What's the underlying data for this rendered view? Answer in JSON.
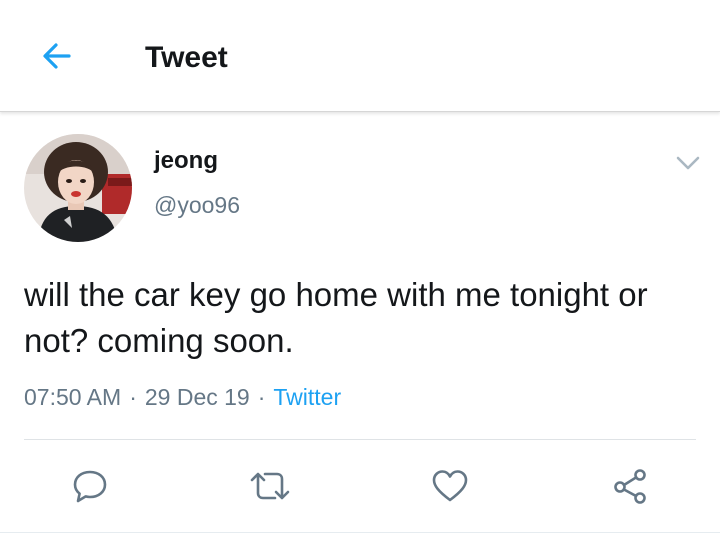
{
  "colors": {
    "accent": "#1da1f2",
    "secondary_text": "#657786",
    "primary_text": "#14171a",
    "icon_gray": "#657786"
  },
  "header": {
    "back_icon": "arrow-left-icon",
    "title": "Tweet"
  },
  "tweet": {
    "author": {
      "avatar_icon": "profile-photo",
      "display_name": "jeong",
      "handle": "@yoo96"
    },
    "menu_icon": "chevron-down-icon",
    "text": "will the car key go home with me tonight or not? coming soon.",
    "time": "07:50 AM",
    "date": "29 Dec 19",
    "source": "Twitter",
    "separator": "·"
  },
  "actions": [
    {
      "name": "reply",
      "icon": "reply-icon"
    },
    {
      "name": "retweet",
      "icon": "retweet-icon"
    },
    {
      "name": "like",
      "icon": "heart-icon"
    },
    {
      "name": "share",
      "icon": "share-icon"
    }
  ]
}
